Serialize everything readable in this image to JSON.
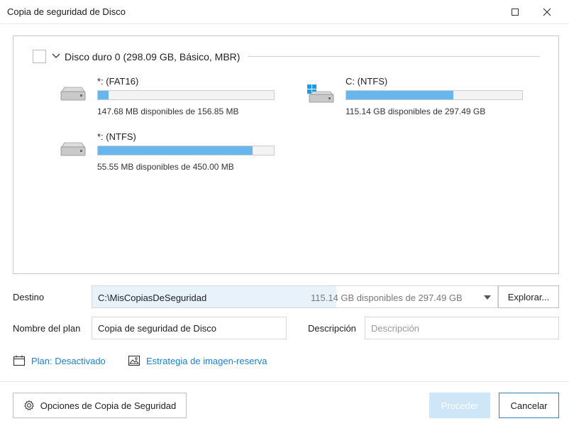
{
  "window": {
    "title": "Copia de seguridad de Disco"
  },
  "disk": {
    "title": "Disco duro 0 (298.09 GB, Básico, MBR)",
    "partitions": [
      {
        "name": "*: (FAT16)",
        "info": "147.68 MB disponibles de 156.85 MB",
        "used_fraction": 0.06,
        "icon": "hdd-icon"
      },
      {
        "name": "C: (NTFS)",
        "info": "115.14 GB disponibles de 297.49 GB",
        "used_fraction": 0.61,
        "icon": "windows-drive-icon"
      },
      {
        "name": "*: (NTFS)",
        "info": "55.55 MB disponibles de 450.00 MB",
        "used_fraction": 0.88,
        "icon": "hdd-icon"
      }
    ]
  },
  "destination": {
    "label": "Destino",
    "path": "C:\\MisCopiasDeSeguridad",
    "space": "115.14 GB disponibles de 297.49 GB",
    "browse_label": "Explorar..."
  },
  "plan": {
    "name_label": "Nombre del plan",
    "name_value": "Copia de seguridad de Disco",
    "description_label": "Descripción",
    "description_placeholder": "Descripción"
  },
  "links": {
    "plan": "Plan: Desactivado",
    "strategy": "Estrategia de imagen-reserva"
  },
  "footer": {
    "options_label": "Opciones de Copia de Seguridad",
    "proceed_label": "Proceder",
    "cancel_label": "Cancelar"
  },
  "colors": {
    "accent": "#1f7fc9",
    "bar_fill": "#68b6ee",
    "proceed_disabled": "#cfe6f8"
  }
}
